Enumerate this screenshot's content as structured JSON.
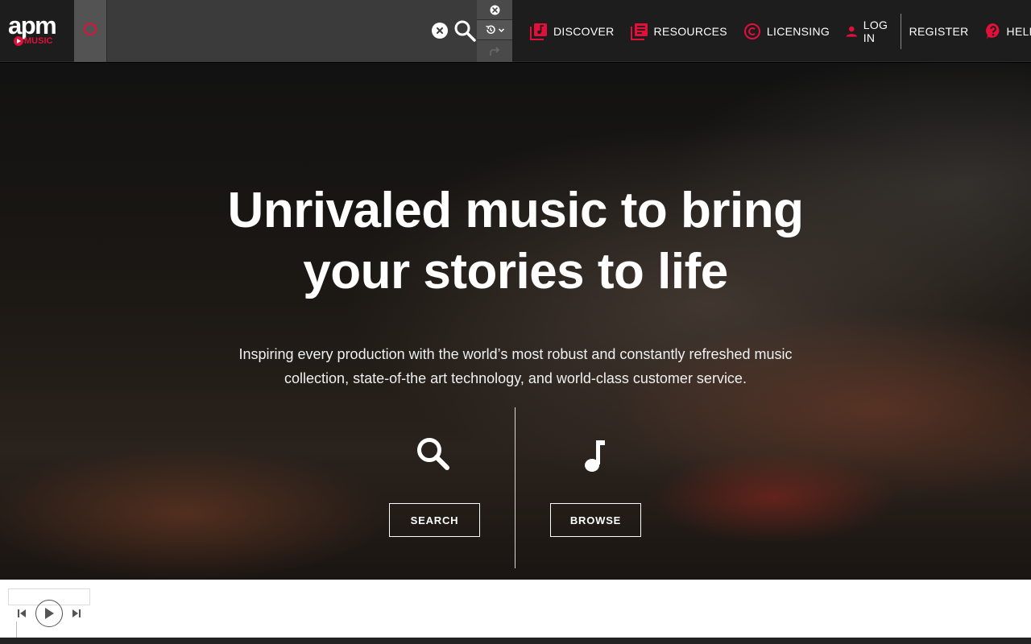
{
  "header": {
    "logo": {
      "top": "apm",
      "bottom": "MUSIC"
    },
    "search": {
      "value": "",
      "placeholder": ""
    },
    "icons": {
      "mode": "ring-icon",
      "clear": "close-circle-icon",
      "search": "search-icon",
      "top_tool": "close-circle-icon",
      "history": "history-icon",
      "redo": "redo-icon"
    },
    "nav": [
      {
        "label": "DISCOVER",
        "icon": "discover-icon"
      },
      {
        "label": "RESOURCES",
        "icon": "resources-icon"
      },
      {
        "label": "LICENSING",
        "icon": "copyright-icon"
      },
      {
        "label": "LOG IN",
        "icon": "user-icon"
      },
      {
        "label": "REGISTER",
        "icon": ""
      },
      {
        "label": "HELP",
        "icon": "help-icon"
      }
    ]
  },
  "hero": {
    "title_line1": "Unrivaled music to bring",
    "title_line2": "your stories to life",
    "subtitle_line1": "Inspiring every production with the world’s most robust and constantly refreshed music",
    "subtitle_line2": "collection, state-of-the art technology, and world-class customer service.",
    "actions": [
      {
        "label": "SEARCH",
        "icon": "search-icon"
      },
      {
        "label": "BROWSE",
        "icon": "music-note-icon"
      }
    ]
  },
  "player": {
    "icons": {
      "prev": "skip-previous-icon",
      "play": "play-icon",
      "next": "skip-next-icon"
    }
  },
  "colors": {
    "accent": "#e0103a",
    "header_bg": "#1d1d1d",
    "search_bg": "#3b3b3b",
    "player_bg": "#ffffff"
  }
}
